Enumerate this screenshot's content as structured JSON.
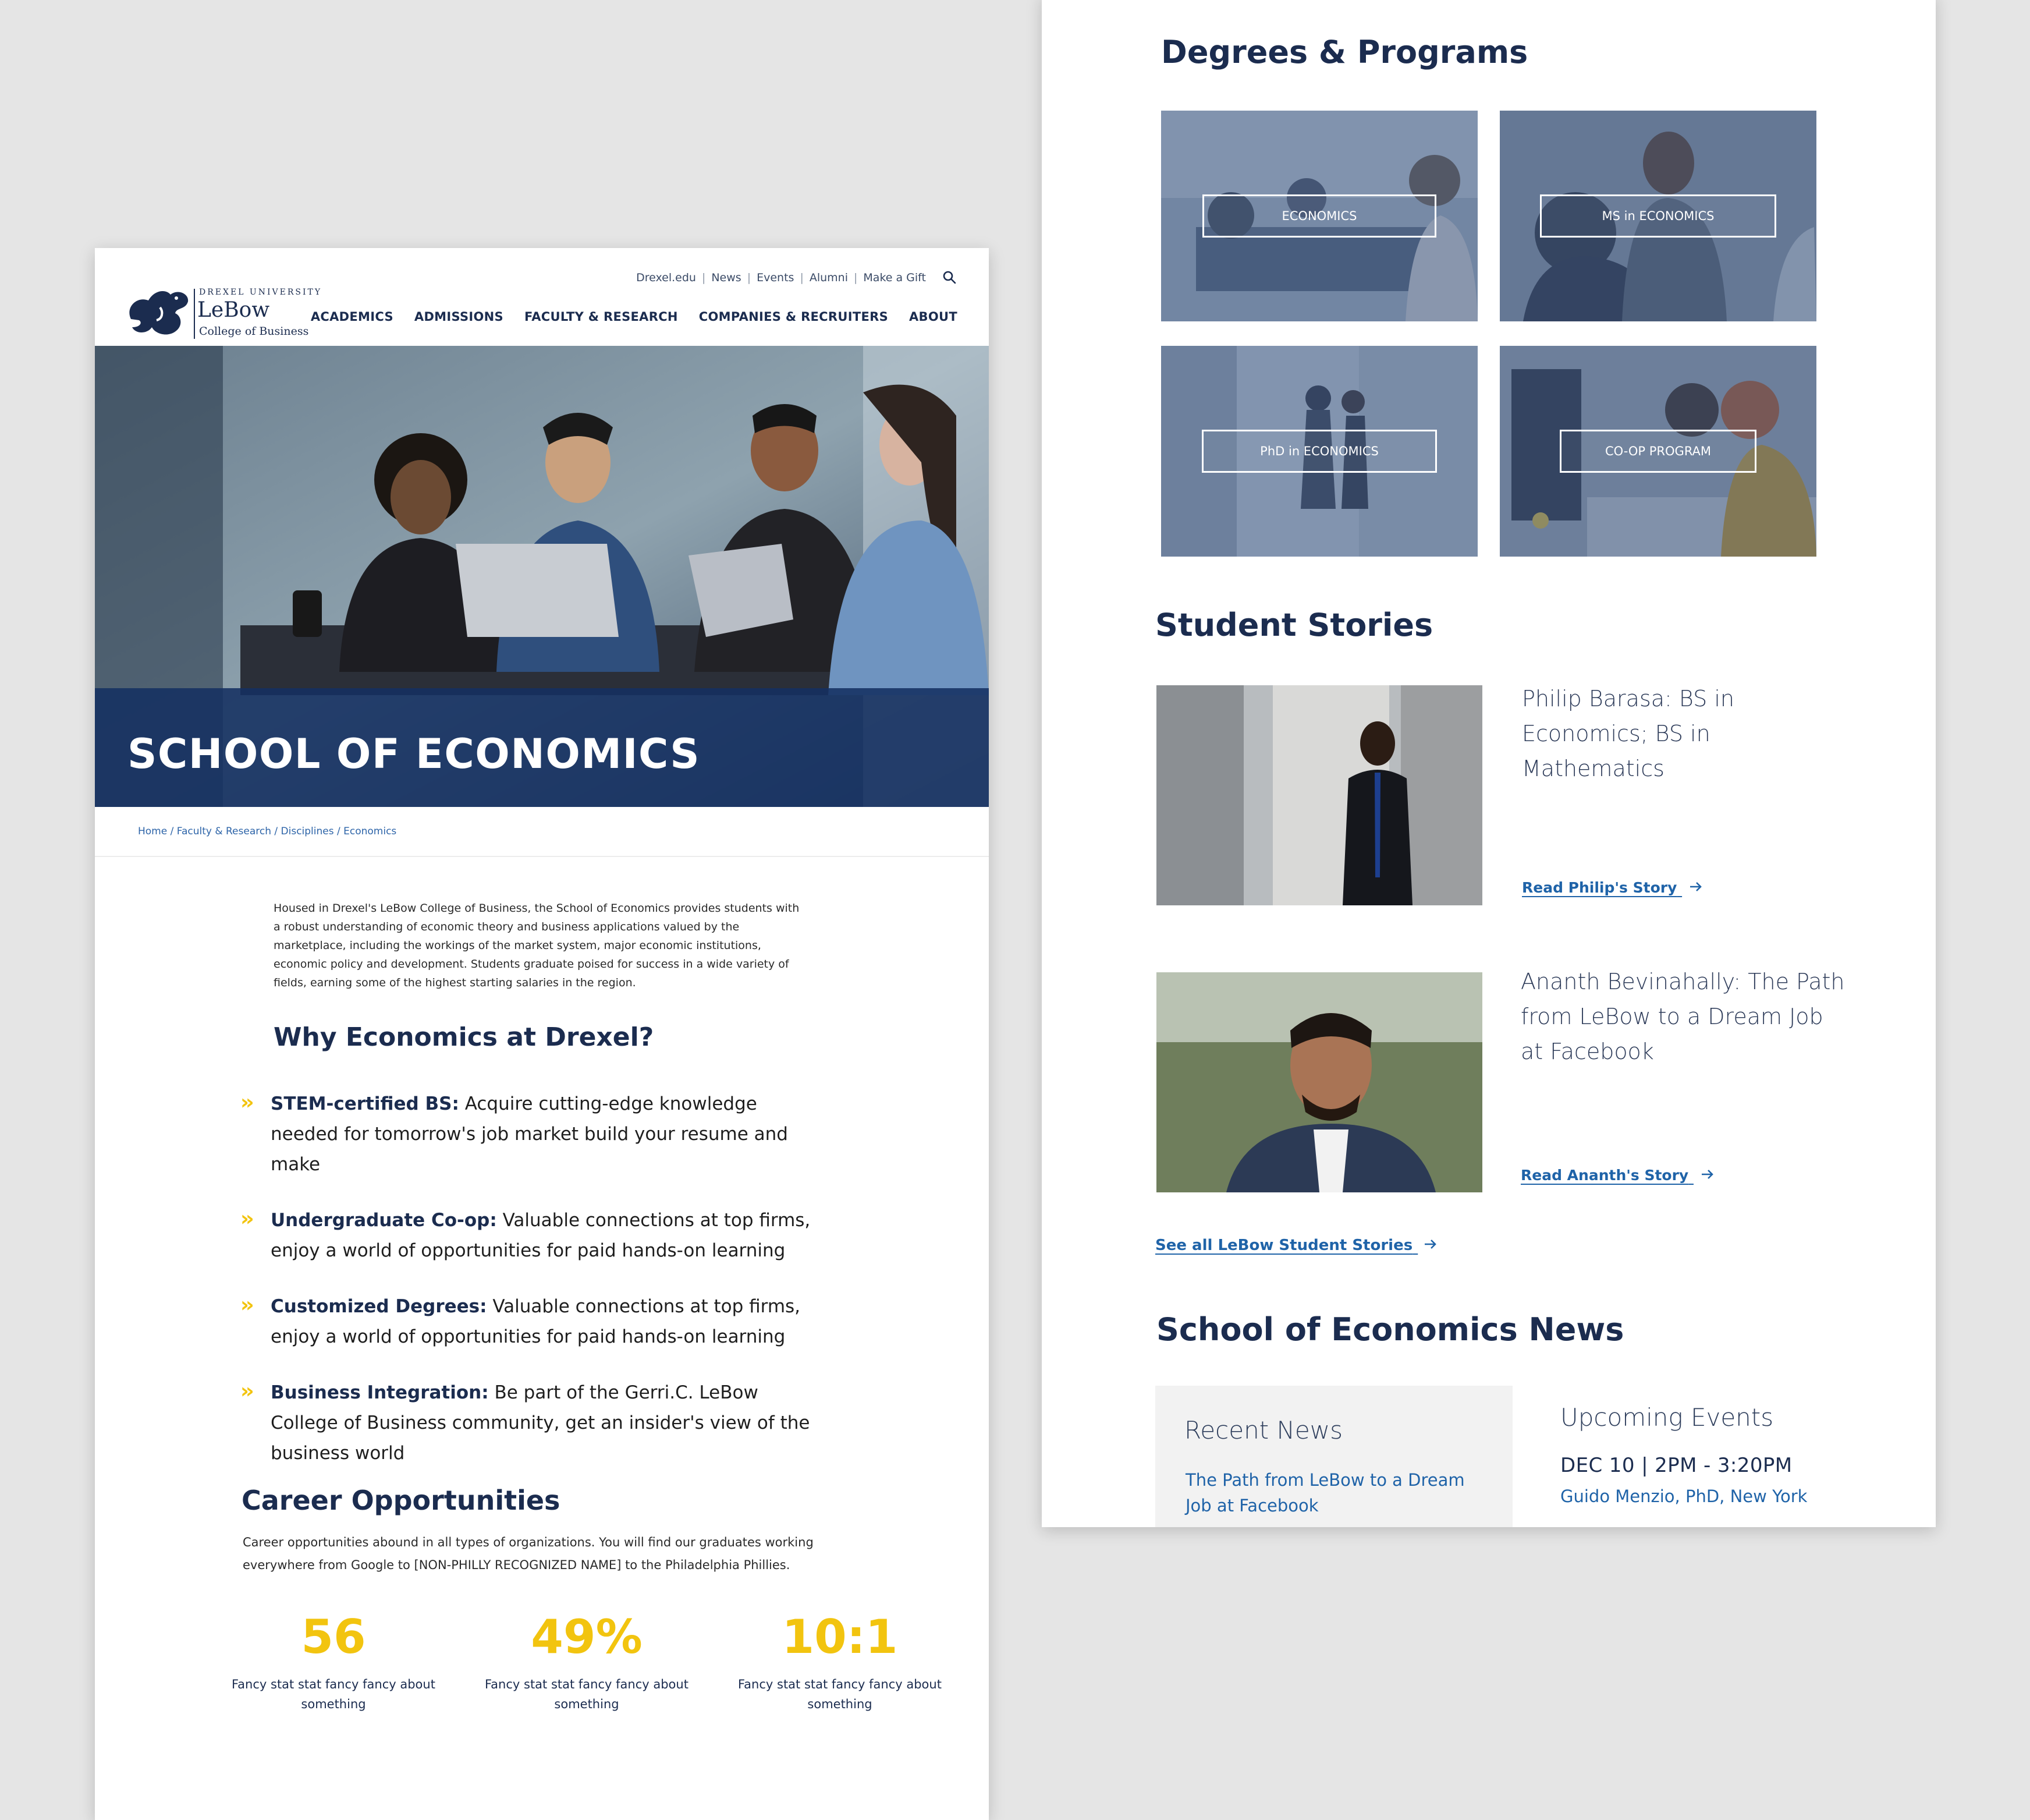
{
  "brand": {
    "university": "DREXEL UNIVERSITY",
    "name": "LeBow",
    "college": "College of Business"
  },
  "utility_nav": [
    "Drexel.edu",
    "News",
    "Events",
    "Alumni",
    "Make a Gift"
  ],
  "main_nav": [
    "ACADEMICS",
    "ADMISSIONS",
    "FACULTY & RESEARCH",
    "COMPANIES & RECRUITERS",
    "ABOUT"
  ],
  "hero": {
    "title": "SCHOOL OF ECONOMICS"
  },
  "breadcrumb": "Home / Faculty & Research / Disciplines / Economics",
  "intro": "Housed in Drexel's LeBow College of Business, the School of Economics provides students with a robust understanding of economic theory and business applications valued by the marketplace, including the workings of the market system, major economic institutions, economic policy and development. Students graduate poised for success in a wide variety of fields, earning some of the highest starting salaries in the region.",
  "why": {
    "heading": "Why Economics at Drexel?",
    "items": [
      {
        "lead": "STEM-certified BS:",
        "text": " Acquire cutting-edge knowledge needed for tomorrow's job market build your resume and make"
      },
      {
        "lead": "Undergraduate Co-op:",
        "text": " Valuable connections at top firms, enjoy a world of opportunities for paid hands-on learning"
      },
      {
        "lead": "Customized Degrees:",
        "text": " Valuable connections at top firms, enjoy a world of opportunities for paid hands-on learning"
      },
      {
        "lead": "Business Integration:",
        "text": " Be part of the Gerri.C. LeBow College of Business community, get an insider's view of the business world"
      }
    ]
  },
  "career": {
    "heading": "Career Opportunities",
    "text": "Career opportunities abound in all types of organizations. You will find our graduates working everywhere from Google to [NON-PHILLY RECOGNIZED NAME] to the Philadelphia Phillies.",
    "stats": [
      {
        "value": "56",
        "label": "Fancy stat stat fancy fancy about something"
      },
      {
        "value": "49%",
        "label": "Fancy stat stat fancy fancy about something"
      },
      {
        "value": "10:1",
        "label": "Fancy stat stat fancy fancy about something"
      }
    ]
  },
  "degrees": {
    "heading": "Degrees & Programs",
    "tiles": [
      "ECONOMICS",
      "MS in ECONOMICS",
      "PhD in ECONOMICS",
      "CO-OP PROGRAM"
    ]
  },
  "stories": {
    "heading": "Student Stories",
    "items": [
      {
        "title": "Philip Barasa: BS in Economics; BS in Mathematics",
        "link": "Read Philip's Story"
      },
      {
        "title": "Ananth Bevinahally: The Path from LeBow to a Dream Job at Facebook",
        "link": "Read Ananth's Story"
      }
    ],
    "see_all": "See all LeBow Student Stories"
  },
  "news": {
    "heading": "School of Economics News",
    "recent_title": "Recent News",
    "recent_item": "The Path from LeBow to a Dream Job at Facebook",
    "events_title": "Upcoming Events",
    "event_date": "DEC 10  |  2PM - 3:20PM",
    "event_speaker": "Guido Menzio, PhD, New York"
  },
  "colors": {
    "navy": "#1b2c4f",
    "gold": "#f2c40f",
    "link_blue": "#1f63a8",
    "hero_overlay": "#143061"
  },
  "icons": [
    "dragon-logo-icon",
    "search-icon",
    "chevron-double-right-icon",
    "arrow-right-icon"
  ]
}
